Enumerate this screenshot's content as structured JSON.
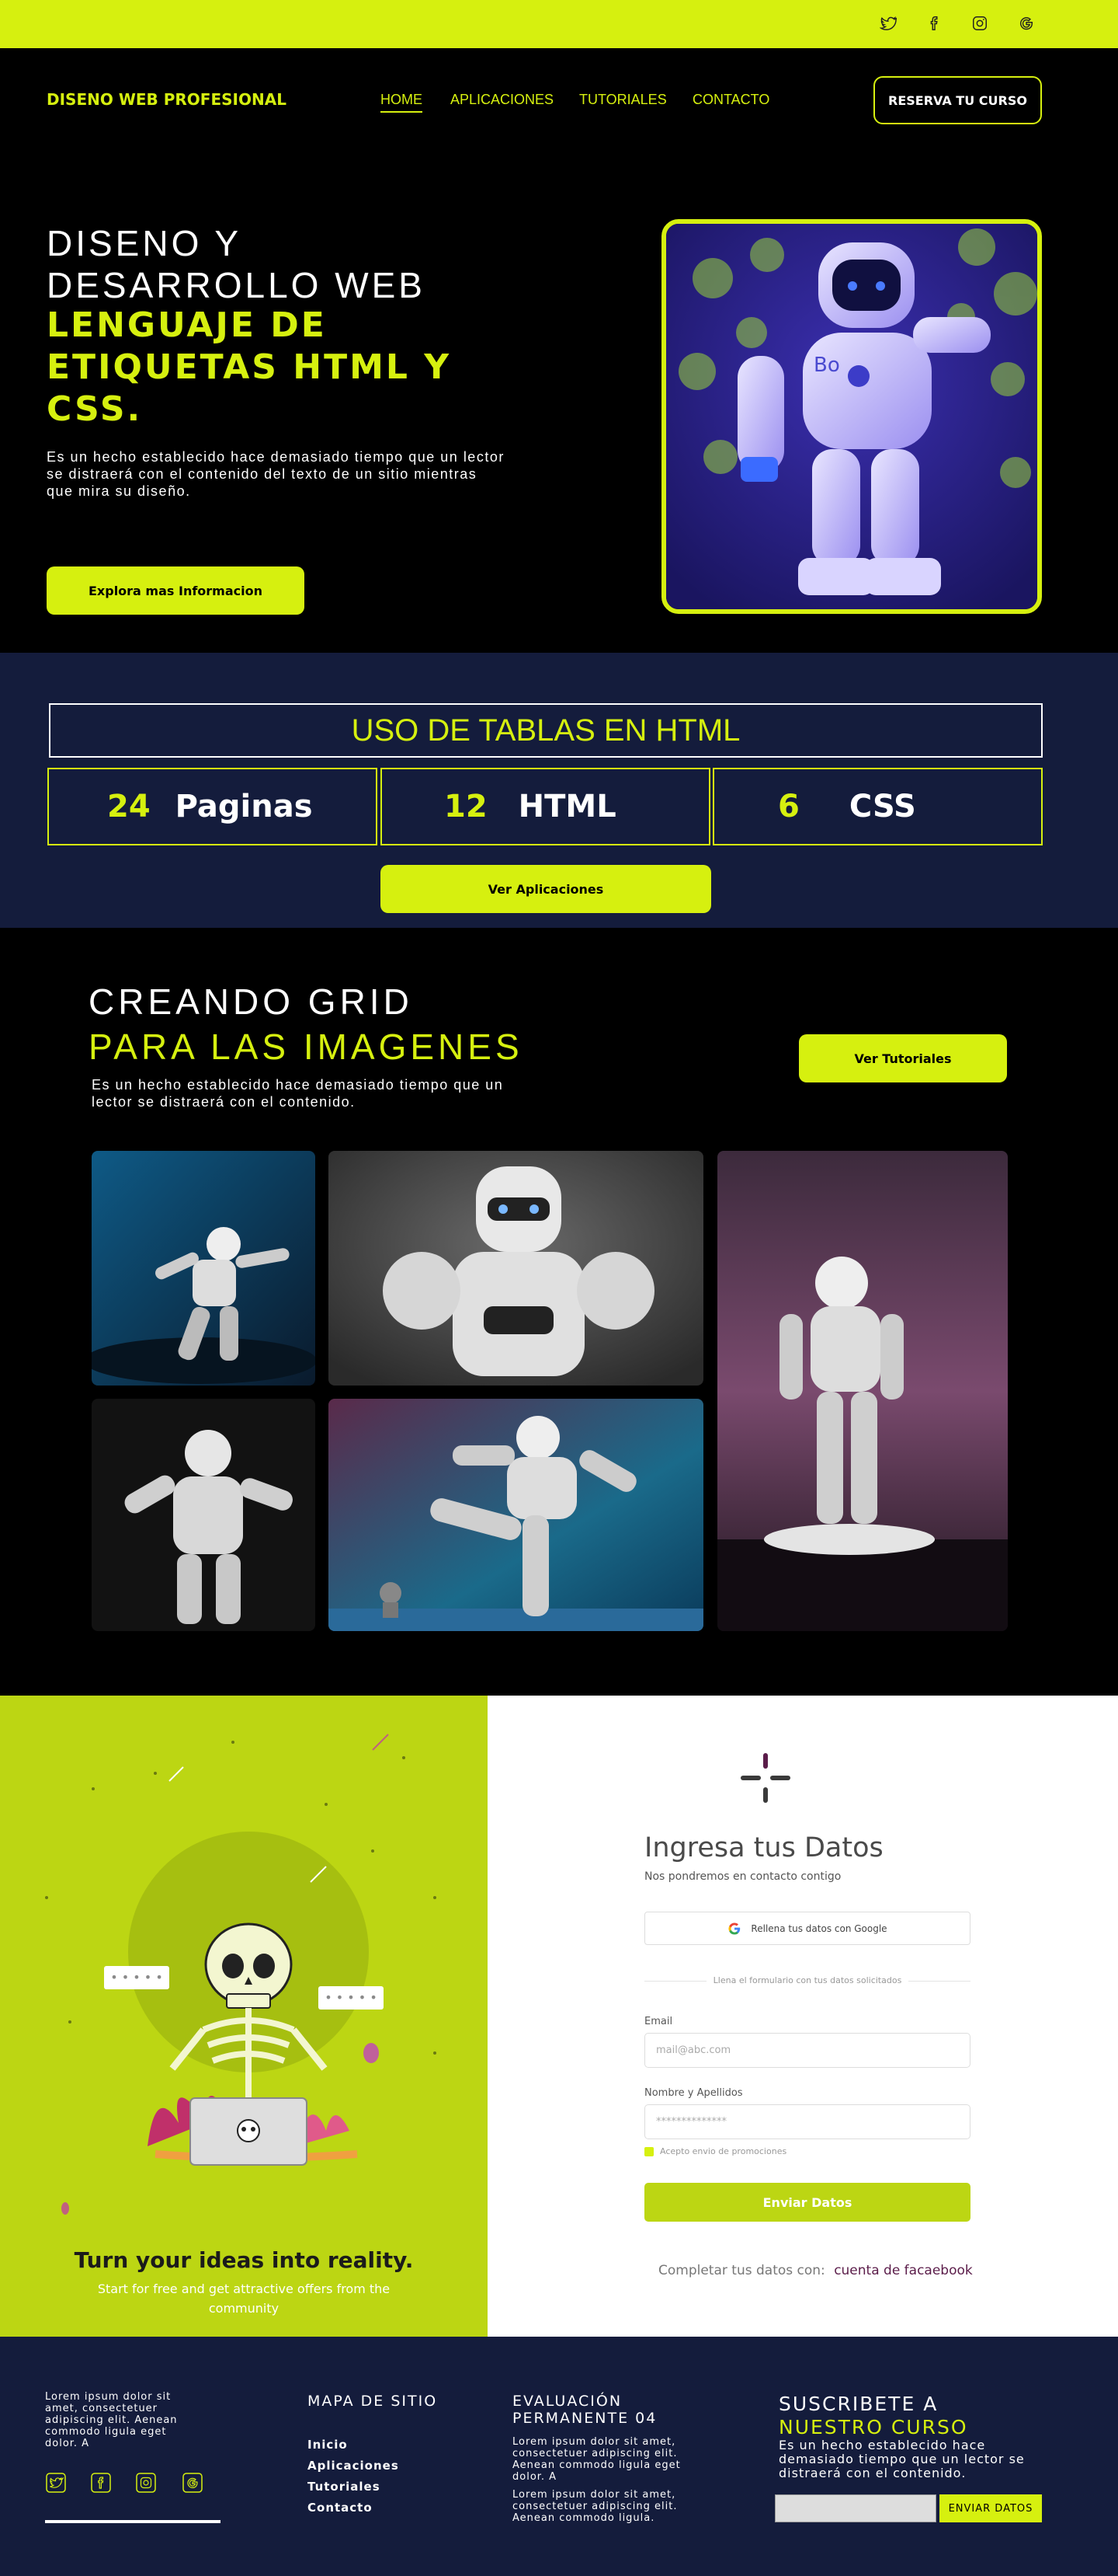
{
  "topbar": {
    "social_icons": [
      "twitter-icon",
      "facebook-icon",
      "instagram-icon",
      "google-icon"
    ],
    "bg": "#d6f00f"
  },
  "header": {
    "brand": "DISENO WEB PROFESIONAL",
    "nav": [
      "HOME",
      "APLICACIONES",
      "TUTORIALES",
      "CONTACTO"
    ],
    "active_nav": "HOME",
    "cta": "RESERVA TU CURSO"
  },
  "hero": {
    "title_line1": "DISENO Y",
    "title_line2": "DESARROLLO WEB",
    "title_accent_1": "LENGUAJE DE",
    "title_accent_2": "ETIQUETAS HTML Y",
    "title_accent_3": "CSS.",
    "paragraph": "Es un hecho establecido hace demasiado tiempo que un lector se distraerá con el contenido del texto de un sitio mientras que mira su diseño.",
    "button": "Explora mas Informacion"
  },
  "stats": {
    "title": "USO DE TABLAS EN HTML",
    "items": [
      {
        "num": "24",
        "label": "Paginas"
      },
      {
        "num": "12",
        "label": "HTML"
      },
      {
        "num": "6",
        "label": "CSS"
      }
    ],
    "button": "Ver Aplicaciones"
  },
  "gallery": {
    "title1": "CREANDO GRID",
    "title2": "PARA LAS IMAGENES",
    "paragraph": "Es un hecho establecido hace demasiado tiempo que un lector se distraerá con el contenido.",
    "button": "Ver Tutoriales"
  },
  "illustration": {
    "heading": "Turn your ideas into reality.",
    "sub": "Start for free and get attractive offers from the community"
  },
  "form": {
    "heading": "Ingresa tus Datos",
    "sub": "Nos pondremos en contacto contigo",
    "google_button": "Rellena tus datos con Google",
    "divider": "Llena el formulario con tus datos solicitados",
    "email_label": "Email",
    "email_placeholder": "mail@abc.com",
    "name_label": "Nombre y Apellidos",
    "name_placeholder": "**************",
    "checkbox_label": "Acepto envio de promociones",
    "submit": "Enviar Datos",
    "fb_prefix": "Completar tus datos con:",
    "fb_link": "cuenta de facaebook"
  },
  "footer": {
    "about": "Lorem ipsum dolor sit amet, consectetuer adipiscing elit. Aenean commodo ligula eget dolor. A",
    "sitemap_title": "MAPA DE SITIO",
    "sitemap_links": [
      "Inicio",
      "Aplicaciones",
      "Tutoriales",
      "Contacto"
    ],
    "eval_title": "EVALUACIÓN PERMANENTE 04",
    "eval_text1": "Lorem ipsum dolor sit amet, consectetuer adipiscing elit. Aenean commodo ligula eget dolor. A",
    "eval_text2": "Lorem ipsum dolor sit amet, consectetuer adipiscing elit. Aenean commodo ligula.",
    "subscribe_title1": "SUSCRIBETE A",
    "subscribe_title2": "NUESTRO CURSO",
    "subscribe_text": "Es un hecho establecido hace demasiado tiempo que un lector se distraerá con el contenido.",
    "subscribe_button": "ENVIAR DATOS"
  },
  "colors": {
    "accent": "#d6f00f",
    "navy": "#141c3c",
    "lime_dark": "#bcd613",
    "black": "#000000"
  }
}
